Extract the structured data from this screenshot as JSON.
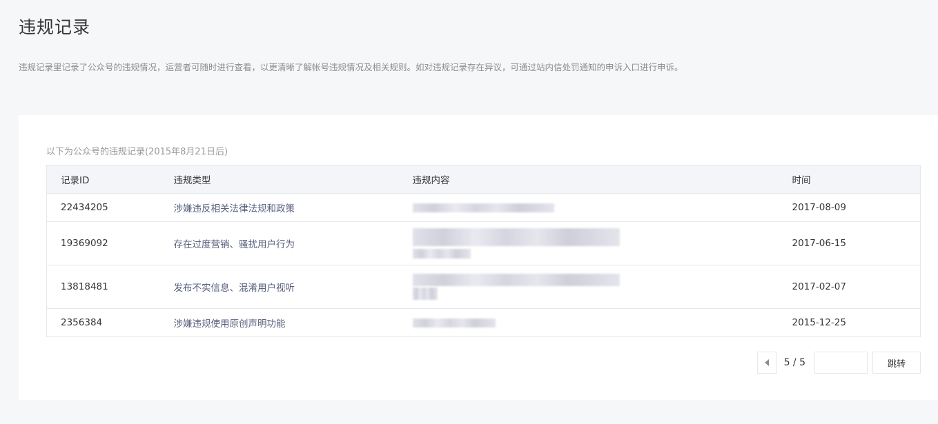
{
  "page": {
    "title": "违规记录",
    "description": "违规记录里记录了公众号的违规情况，运营者可随时进行查看，以更清晰了解帐号违规情况及相关规则。如对违规记录存在异议，可通过站内信处罚通知的申诉入口进行申诉。"
  },
  "records": {
    "caption": "以下为公众号的违规记录(2015年8月21日后)",
    "columns": [
      "记录ID",
      "违规类型",
      "违规内容",
      "时间"
    ],
    "rows": [
      {
        "id": "22434205",
        "type": "涉嫌违反相关法律法规和政策",
        "date": "2017-08-09"
      },
      {
        "id": "19369092",
        "type": "存在过度营销、骚扰用户行为",
        "date": "2017-06-15"
      },
      {
        "id": "13818481",
        "type": "发布不实信息、混淆用户视听",
        "date": "2017-02-07"
      },
      {
        "id": "2356384",
        "type": "涉嫌违规使用原创声明功能",
        "date": "2015-12-25"
      }
    ]
  },
  "pagination": {
    "page_indicator": "5 / 5",
    "jump_input_value": "",
    "jump_label": "跳转",
    "prev_icon": "triangle-left-icon"
  }
}
